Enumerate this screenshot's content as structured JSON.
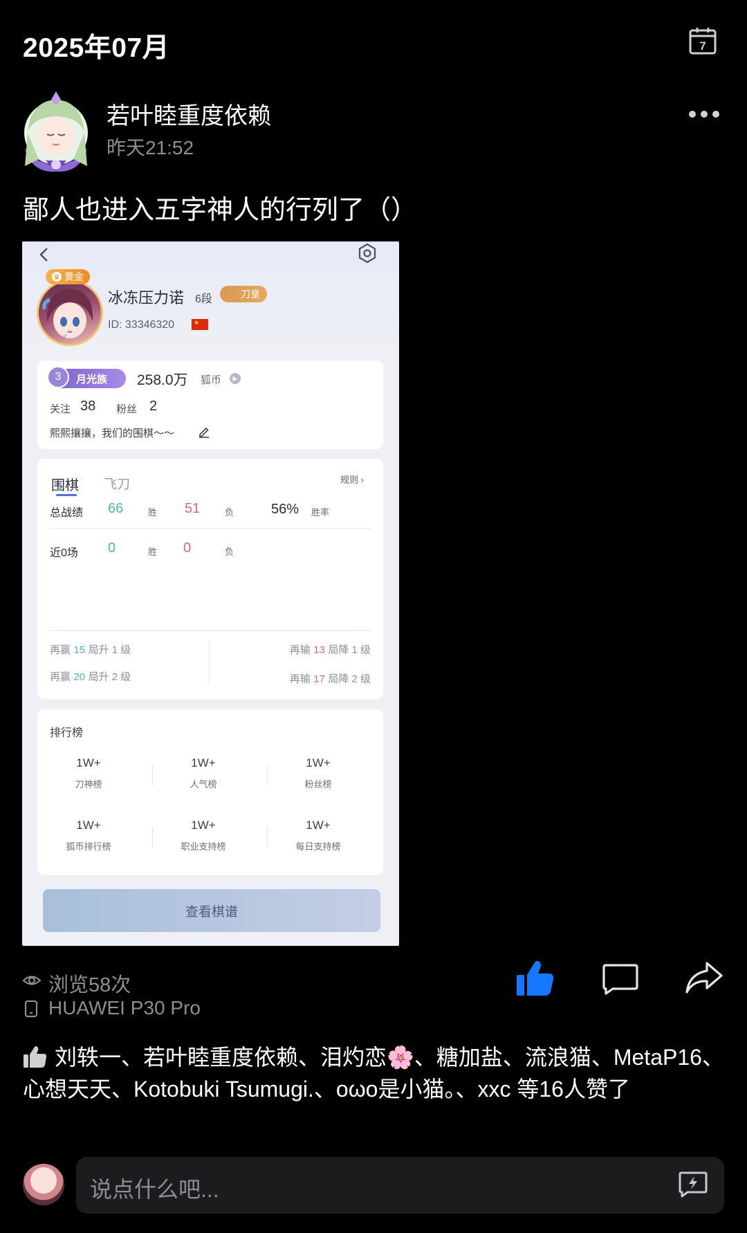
{
  "header": {
    "month": "2025年07月",
    "calendar_day": "7"
  },
  "post": {
    "username": "若叶睦重度依赖",
    "timestamp": "昨天21:52",
    "text": "鄙人也进入五字神人的行列了（）"
  },
  "screenshot": {
    "level_badge": "黄金",
    "player_name": "冰冻压力诺",
    "rank": "6段",
    "title_badge": "刀皇",
    "player_id": "ID: 33346320",
    "clan_level": "3",
    "clan_name": "月光族",
    "coins": "258.0万",
    "coins_label": "狐币",
    "follow_label": "关注",
    "follow_count": "38",
    "fans_label": "粉丝",
    "fans_count": "2",
    "motto": "熙熙攘攘，我们的围棋～～",
    "tabs": [
      "围棋",
      "飞刀"
    ],
    "rules_label": "规则",
    "total": {
      "label": "总战绩",
      "wins": "66",
      "win_label": "胜",
      "losses": "51",
      "loss_label": "负",
      "winrate": "56%",
      "winrate_label": "胜率"
    },
    "recent": {
      "label": "近0场",
      "wins": "0",
      "win_label": "胜",
      "losses": "0",
      "loss_label": "负"
    },
    "progress": {
      "up1": {
        "prefix": "再赢",
        "n": "15",
        "suffix": "局升 1 级"
      },
      "up2": {
        "prefix": "再赢",
        "n": "20",
        "suffix": "局升 2 级"
      },
      "down1": {
        "prefix": "再输",
        "n": "13",
        "suffix": "局降 1 级"
      },
      "down2": {
        "prefix": "再输",
        "n": "17",
        "suffix": "局降 2 级"
      }
    },
    "leaderboard_title": "排行榜",
    "leaderboards": [
      {
        "value": "1W+",
        "name": "刀神榜"
      },
      {
        "value": "1W+",
        "name": "人气榜"
      },
      {
        "value": "1W+",
        "name": "粉丝榜"
      },
      {
        "value": "1W+",
        "name": "狐币排行榜"
      },
      {
        "value": "1W+",
        "name": "职业支持榜"
      },
      {
        "value": "1W+",
        "name": "每日支持榜"
      }
    ],
    "view_button": "查看棋谱"
  },
  "stats": {
    "views": "浏览58次",
    "device": "HUAWEI P30 Pro"
  },
  "likes": {
    "text": "刘轶一、若叶睦重度依赖、泪灼恋🌸、糖加盐、流浪猫、MetaP16、心想天天、Kotobuki Tsumugi.、oωo是小猫。、xxc 等16人赞了"
  },
  "comment": {
    "placeholder": "说点什么吧..."
  },
  "colors": {
    "like_active": "#1677ff",
    "background": "#000000",
    "muted": "#8e8e93"
  }
}
